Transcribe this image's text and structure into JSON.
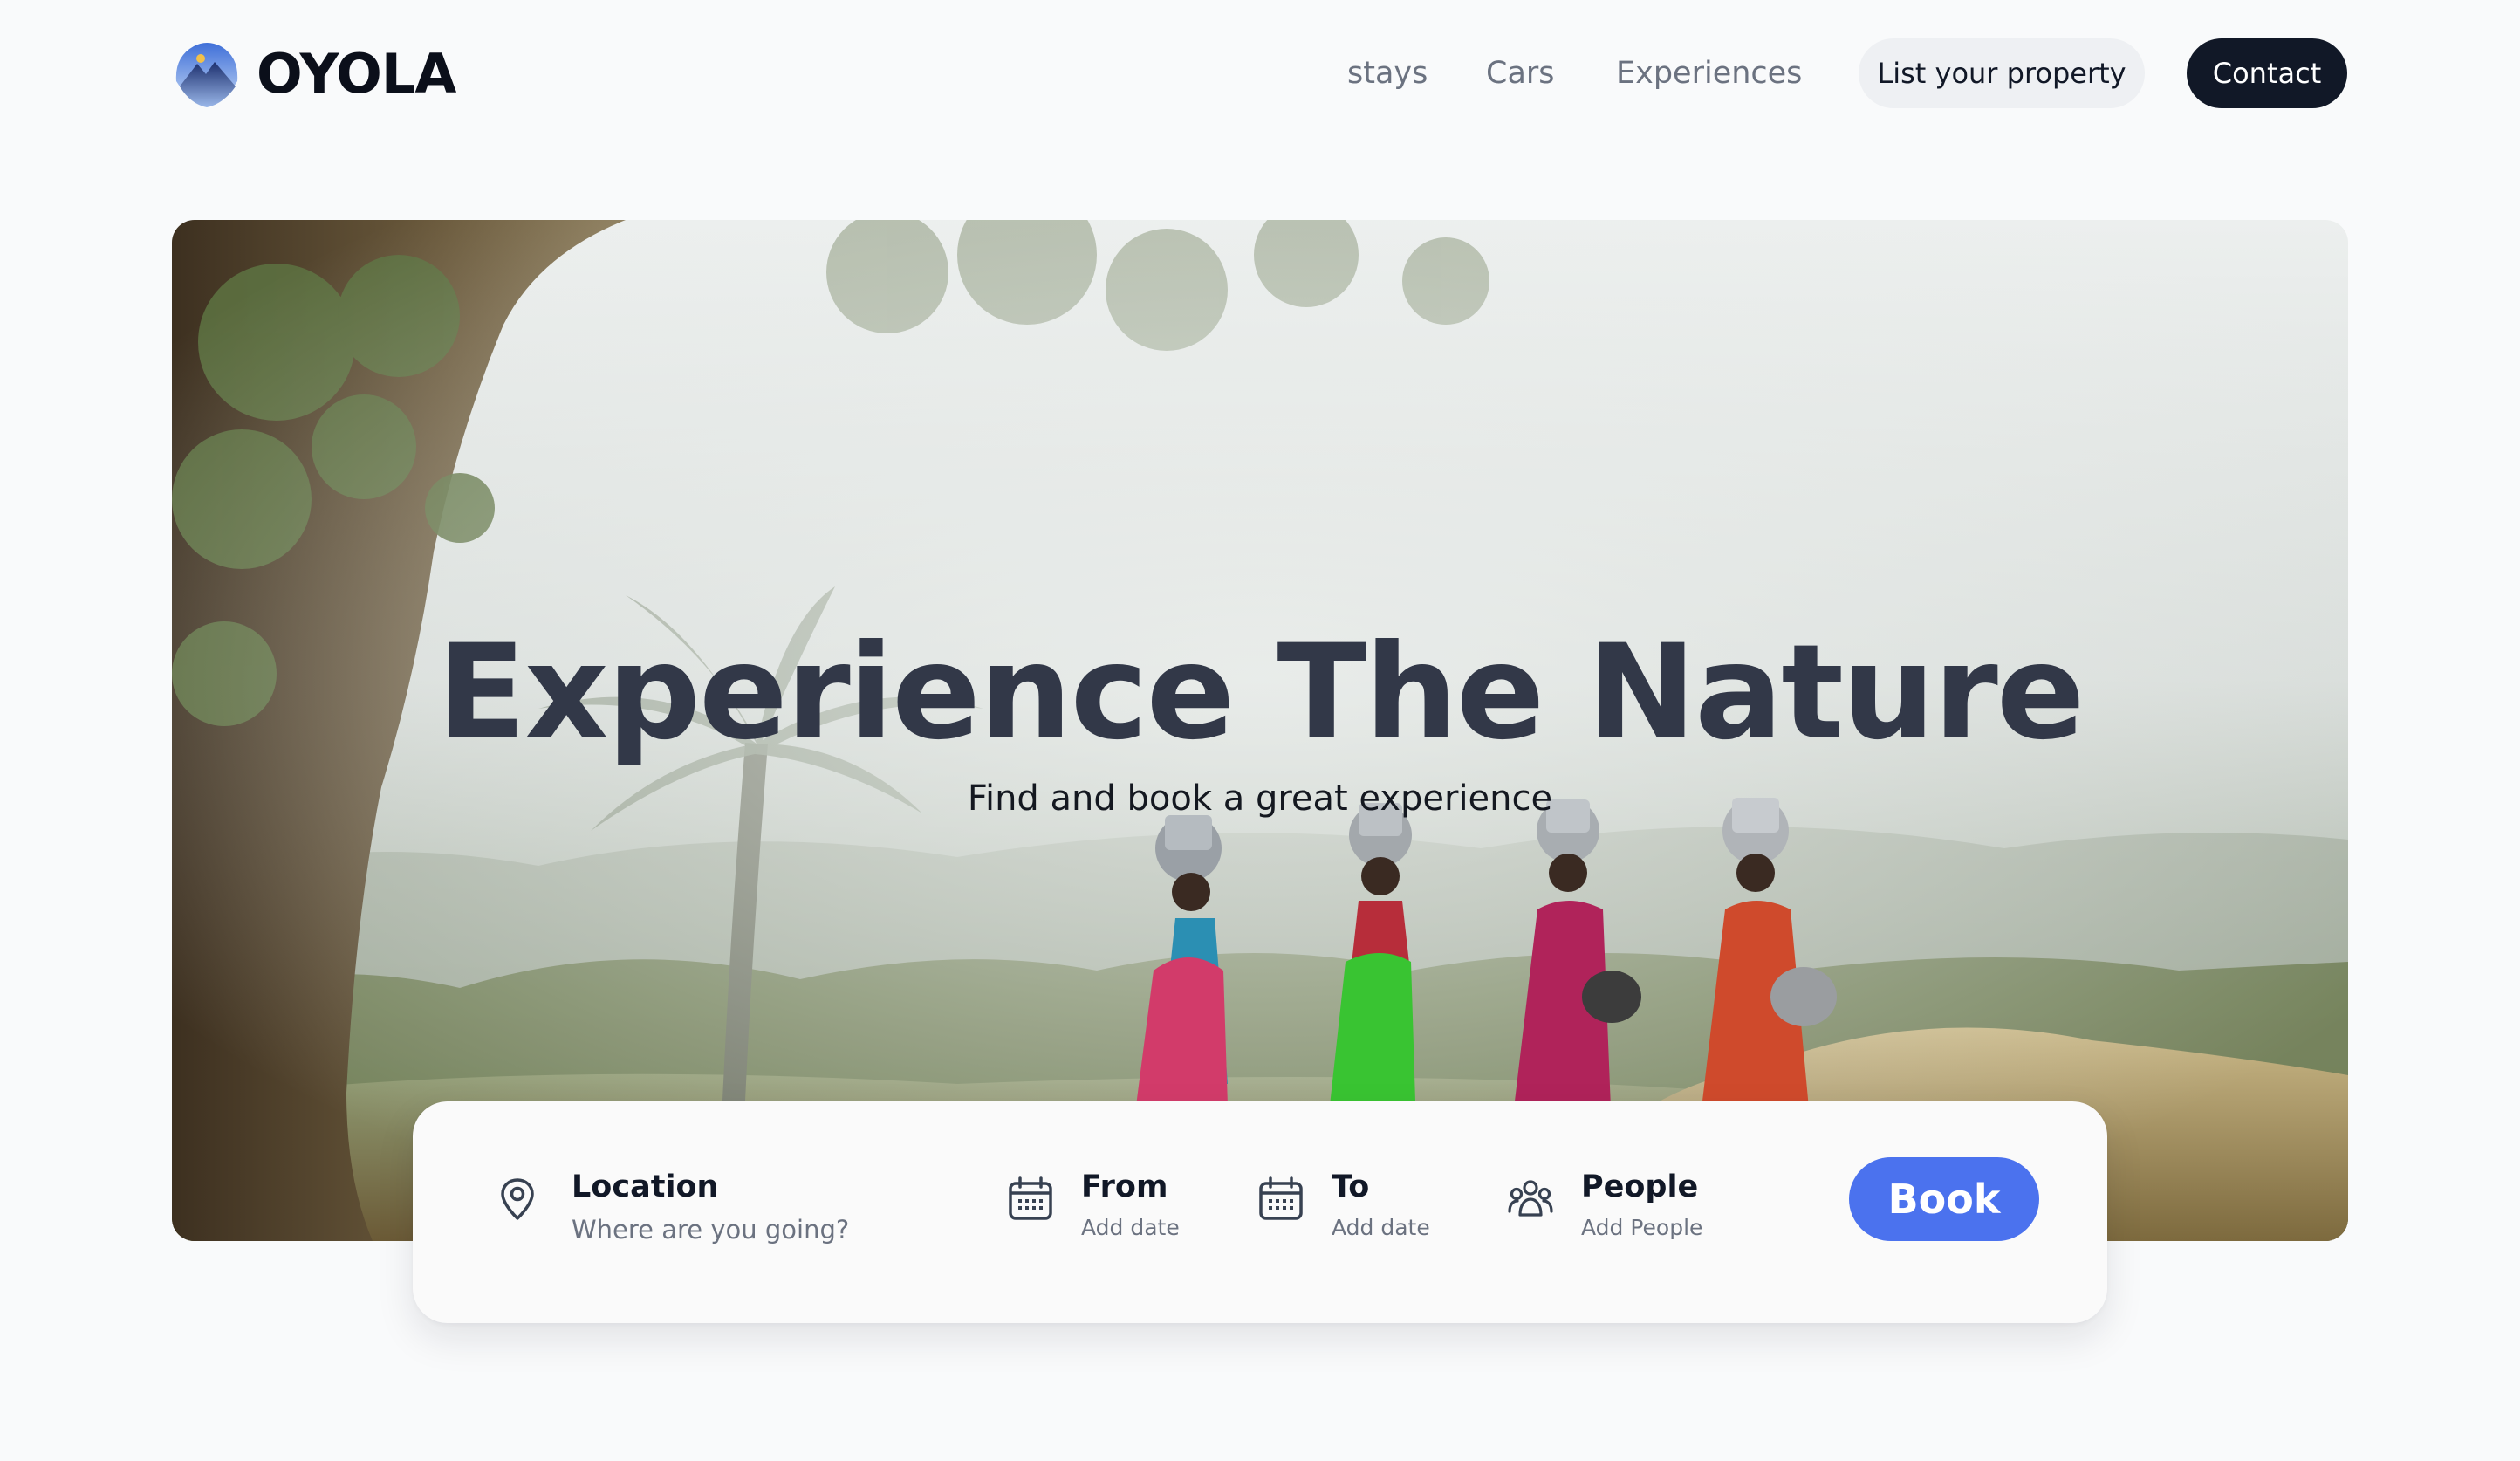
{
  "brand": {
    "name": "OYOLA",
    "logo_icon": "mountain-icon"
  },
  "nav": {
    "links": [
      "stays",
      "Cars",
      "Experiences"
    ],
    "list_property": "List your property",
    "contact": "Contact"
  },
  "hero": {
    "title": "Experience The Nature",
    "subtitle": "Find and book a great experience"
  },
  "search": {
    "location": {
      "label": "Location",
      "hint": "Where are you going?",
      "icon": "location-pin-icon"
    },
    "from": {
      "label": "From",
      "hint": "Add date",
      "icon": "calendar-icon"
    },
    "to": {
      "label": "To",
      "hint": "Add date",
      "icon": "calendar-icon"
    },
    "people": {
      "label": "People",
      "hint": "Add People",
      "icon": "people-icon"
    },
    "book": "Book"
  },
  "colors": {
    "accent": "#4b72ee",
    "dark": "#111827",
    "muted": "#6b7280",
    "page_bg": "#f9fafb"
  }
}
